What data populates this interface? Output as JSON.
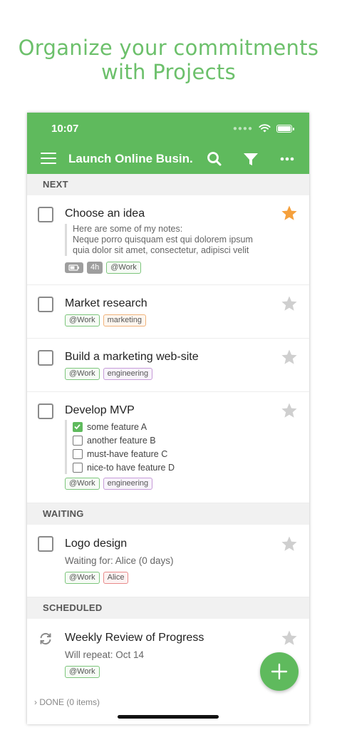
{
  "headline": {
    "line1": "Organize your commitments",
    "line2": "with Projects"
  },
  "status_bar": {
    "time": "10:07"
  },
  "app_bar": {
    "title": "Launch Online Busin..."
  },
  "sections": {
    "next": "NEXT",
    "waiting": "WAITING",
    "scheduled": "SCHEDULED",
    "done": "DONE (0 items)"
  },
  "tasks": {
    "choose_idea": {
      "title": "Choose an idea",
      "starred": true,
      "notes": [
        "Here are some of my notes:",
        "Neque porro quisquam est qui dolorem ipsum",
        "quia dolor sit amet, consectetur, adipisci velit"
      ],
      "estimate": "4h",
      "context": "@Work"
    },
    "market_research": {
      "title": "Market research",
      "context": "@Work",
      "tag": "marketing"
    },
    "build_website": {
      "title": "Build a marketing web-site",
      "context": "@Work",
      "tag": "engineering"
    },
    "develop_mvp": {
      "title": "Develop MVP",
      "checklist": [
        {
          "label": "some feature A",
          "checked": true
        },
        {
          "label": "another feature B",
          "checked": false
        },
        {
          "label": "must-have feature C",
          "checked": false
        },
        {
          "label": "nice-to have feature D",
          "checked": false
        }
      ],
      "context": "@Work",
      "tag": "engineering"
    },
    "logo_design": {
      "title": "Logo design",
      "waiting": "Waiting for: Alice (0 days)",
      "context": "@Work",
      "person": "Alice"
    },
    "weekly_review": {
      "title": "Weekly Review of  Progress",
      "repeat": "Will repeat: Oct 14",
      "context": "@Work"
    }
  },
  "colors": {
    "accent": "#5fba5d",
    "star_active": "#f5a03c",
    "star_inactive": "#cfcfcf"
  },
  "icons": [
    "menu-icon",
    "search-icon",
    "filter-icon",
    "more-icon",
    "star-icon",
    "repeat-icon",
    "plus-icon",
    "wifi-icon",
    "battery-icon"
  ]
}
